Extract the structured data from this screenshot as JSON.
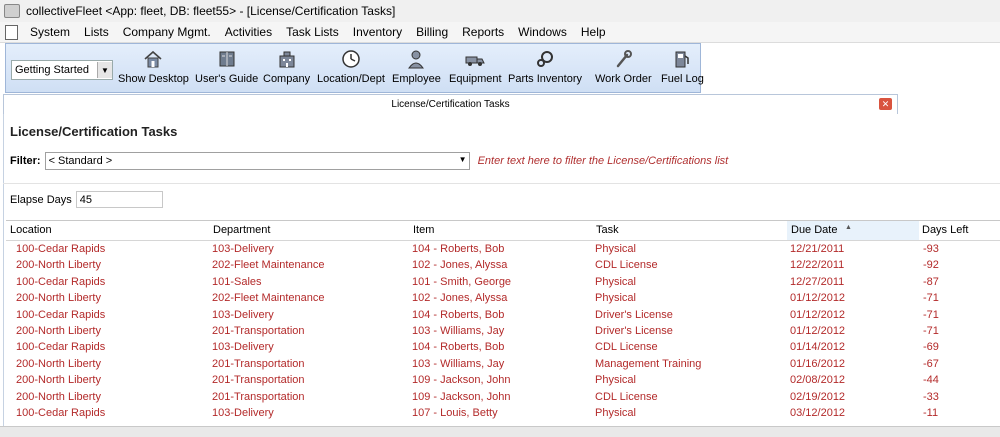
{
  "window": {
    "title": "collectiveFleet <App: fleet, DB: fleet55> - [License/Certification Tasks]"
  },
  "menu": [
    "System",
    "Lists",
    "Company Mgmt.",
    "Activities",
    "Task Lists",
    "Inventory",
    "Billing",
    "Reports",
    "Windows",
    "Help"
  ],
  "toolbar": {
    "combo_value": "Getting Started",
    "buttons": [
      {
        "label": "Show Desktop",
        "icon": "house-icon"
      },
      {
        "label": "User's Guide",
        "icon": "book-icon"
      },
      {
        "label": "Company",
        "icon": "building-icon"
      },
      {
        "label": "Location/Dept",
        "icon": "clock-icon"
      },
      {
        "label": "Employee",
        "icon": "person-icon"
      },
      {
        "label": "Equipment",
        "icon": "truck-icon"
      },
      {
        "label": "Parts Inventory",
        "icon": "gears-icon"
      },
      {
        "label": "Work Order",
        "icon": "wrench-icon"
      },
      {
        "label": "Fuel Log",
        "icon": "fuel-pump-icon"
      }
    ]
  },
  "document": {
    "tab_title": "License/Certification Tasks",
    "page_title": "License/Certification Tasks"
  },
  "filter": {
    "label": "Filter:",
    "value": "< Standard >",
    "hint": "Enter text here to filter the License/Certifications list"
  },
  "elapse": {
    "label": "Elapse Days",
    "value": "45"
  },
  "table": {
    "columns": [
      "Location",
      "Department",
      "Item",
      "Task",
      "Due Date",
      "Days Left"
    ],
    "rows": [
      [
        "100-Cedar Rapids",
        "103-Delivery",
        "104 - Roberts, Bob",
        "Physical",
        "12/21/2011",
        "-93"
      ],
      [
        "200-North Liberty",
        "202-Fleet Maintenance",
        "102 - Jones, Alyssa",
        "CDL License",
        "12/22/2011",
        "-92"
      ],
      [
        "100-Cedar Rapids",
        "101-Sales",
        "101 - Smith, George",
        "Physical",
        "12/27/2011",
        "-87"
      ],
      [
        "200-North Liberty",
        "202-Fleet Maintenance",
        "102 - Jones, Alyssa",
        "Physical",
        "01/12/2012",
        "-71"
      ],
      [
        "100-Cedar Rapids",
        "103-Delivery",
        "104 - Roberts, Bob",
        "Driver's License",
        "01/12/2012",
        "-71"
      ],
      [
        "200-North Liberty",
        "201-Transportation",
        "103 - Williams, Jay",
        "Driver's License",
        "01/12/2012",
        "-71"
      ],
      [
        "100-Cedar Rapids",
        "103-Delivery",
        "104 - Roberts, Bob",
        "CDL License",
        "01/14/2012",
        "-69"
      ],
      [
        "200-North Liberty",
        "201-Transportation",
        "103 - Williams, Jay",
        "Management Training",
        "01/16/2012",
        "-67"
      ],
      [
        "200-North Liberty",
        "201-Transportation",
        "109 - Jackson, John",
        "Physical",
        "02/08/2012",
        "-44"
      ],
      [
        "200-North Liberty",
        "201-Transportation",
        "109 - Jackson, John",
        "CDL License",
        "02/19/2012",
        "-33"
      ],
      [
        "100-Cedar Rapids",
        "103-Delivery",
        "107 - Louis, Betty",
        "Physical",
        "03/12/2012",
        "-11"
      ]
    ]
  },
  "colors": {
    "row_text": "#b32a2a",
    "toolbar_bg": "#d6e4f7",
    "close_button": "#d9543f"
  }
}
